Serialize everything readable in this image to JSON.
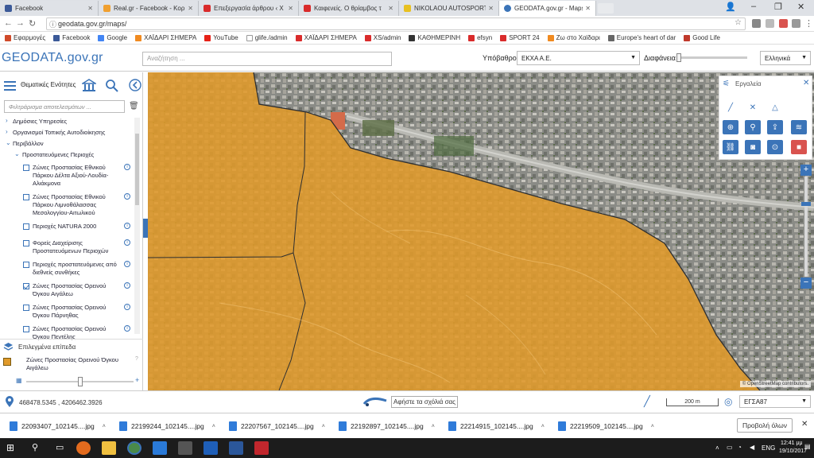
{
  "browser": {
    "tabs": [
      {
        "title": "Facebook",
        "color": "#3b5998",
        "active": false
      },
      {
        "title": "Real.gr - Facebook - Κορ",
        "color": "#f0a030",
        "active": false
      },
      {
        "title": "Επεξεργασία άρθρου ‹ Χ",
        "color": "#d92b2b",
        "active": false
      },
      {
        "title": "Καιφενείς. Ο θρίαμβος τ",
        "color": "#d92b2b",
        "active": false
      },
      {
        "title": "NIKOLAOU AUTOSPORT",
        "color": "#e8c020",
        "active": false
      },
      {
        "title": "GEODATA.gov.gr - Maps",
        "color": "#3b74b8",
        "active": true
      }
    ],
    "url": "geodata.gov.gr/maps/",
    "bookmarks": [
      {
        "label": "Εφαρμογές",
        "color": "#d04a2a"
      },
      {
        "label": "Facebook",
        "color": "#3b5998"
      },
      {
        "label": "Google",
        "color": "#4285f4"
      },
      {
        "label": "ΧΑΪΔΑΡΙ ΣΗΜΕΡΑ",
        "color": "#f08a20"
      },
      {
        "label": "YouTube",
        "color": "#e62117"
      },
      {
        "label": "glife./admin",
        "color": "#ffffff"
      },
      {
        "label": "ΧΑΪΔΑΡΙ ΣΗΜΕΡΑ",
        "color": "#d92b2b"
      },
      {
        "label": "XS/admin",
        "color": "#d92b2b"
      },
      {
        "label": "ΚΑΘΗΜΕΡΙΝΗ",
        "color": "#333333"
      },
      {
        "label": "efsyn",
        "color": "#d92b2b"
      },
      {
        "label": "SPORT 24",
        "color": "#d92b2b"
      },
      {
        "label": "Ζω στο Χαϊδαρι",
        "color": "#f08a20"
      },
      {
        "label": "Europe's heart of dar",
        "color": "#666666"
      },
      {
        "label": "Good Life",
        "color": "#c0392b"
      }
    ]
  },
  "header": {
    "logo": "GEODATA.gov.gr",
    "search_placeholder": "Αναζήτηση ...",
    "basemap_label": "Υπόβαθρο",
    "basemap_value": "ΕΚΧΑ Α.Ε.",
    "opacity_label": "Διαφάνεια",
    "opacity_value": 0.02,
    "language_value": "Ελληνικά"
  },
  "panel": {
    "title": "Θεματικές Ενότητες",
    "filter_placeholder": "Φιλτράρισμα αποτελεσμάτων ...",
    "categories": [
      {
        "label": "Δημόσιες Υπηρεσίες",
        "expanded": false
      },
      {
        "label": "Οργανισμοί Τοπικής Αυτοδιοίκησης",
        "expanded": false
      },
      {
        "label": "Περιβάλλον",
        "expanded": true
      }
    ],
    "subcategory": "Προστατευόμενες Περιοχές",
    "layers": [
      {
        "lines": [
          "Ζώνες Προστασίας Εθνικού",
          "Πάρκου Δέλτα Αξιού-Λουδία-",
          "Αλιάκμονα"
        ],
        "checked": false
      },
      {
        "lines": [
          "Ζώνες Προστασίας Εθνικού",
          "Πάρκου Λιμνοθάλασσας",
          "Μεσολογγίου-Αιτωλικού"
        ],
        "checked": false
      },
      {
        "lines": [
          "Περιοχές NATURA 2000"
        ],
        "checked": false
      },
      {
        "lines": [
          "Φορείς Διαχείρισης",
          "Προστατευόμενων Περιοχών"
        ],
        "checked": false
      },
      {
        "lines": [
          "Περιοχές προστατευόμενες από",
          "διεθνείς συνθήκες"
        ],
        "checked": false
      },
      {
        "lines": [
          "Ζώνες Προστασίας Ορεινού",
          "Όγκου Αιγάλεω"
        ],
        "checked": true
      },
      {
        "lines": [
          "Ζώνες Προστασίας Ορεινού",
          "Όγκου Πάρνηθας"
        ],
        "checked": false
      },
      {
        "lines": [
          "Ζώνες Προστασίας Ορεινού",
          "Όγκου Πεντέλης"
        ],
        "checked": false
      }
    ],
    "selected_title": "Επιλεγμένα επίπεδα",
    "selected_layer": [
      "Ζώνες Προστασίας Ορεινού Όγκου",
      "Αιγάλεω"
    ],
    "selected_opacity": 0.5,
    "layer_color": "#e09a2a"
  },
  "tools": {
    "title": "Εργαλεία"
  },
  "map": {
    "attribution": "© OpenStreetMap contributors."
  },
  "status": {
    "coordinates": "468478.5345 , 4206462.3926",
    "feedback": "Αφήστε τα σχόλιά σας",
    "scale": "200 m",
    "crs": "ΕΓΣΑ87"
  },
  "downloads": {
    "files": [
      "22093407_102145....jpg",
      "22199244_102145....jpg",
      "22207567_102145....jpg",
      "22192897_102145....jpg",
      "22214915_102145....jpg",
      "22219509_102145....jpg"
    ],
    "show_all": "Προβολή όλων"
  },
  "taskbar": {
    "time": "12:41 μμ",
    "date": "19/10/2017",
    "language": "ENG"
  }
}
